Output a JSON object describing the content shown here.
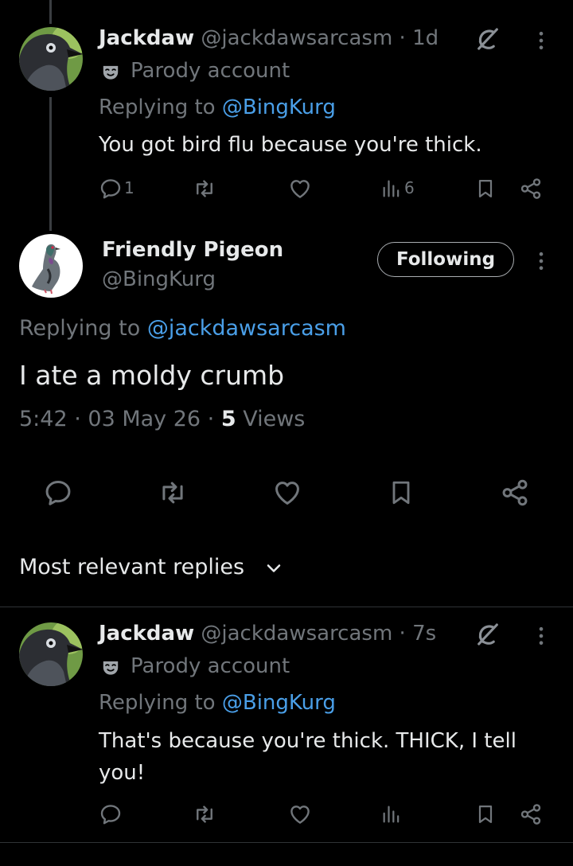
{
  "reply1": {
    "display_name": "Jackdaw",
    "handle": "@jackdawsarcasm",
    "time": "1d",
    "badge_text": "Parody account",
    "replying_prefix": "Replying to",
    "replying_to": "@BingKurg",
    "text": "You got bird flu because you're thick.",
    "reply_count": "1",
    "view_count": "6"
  },
  "main": {
    "display_name": "Friendly Pigeon",
    "handle": "@BingKurg",
    "follow_label": "Following",
    "replying_prefix": "Replying to",
    "replying_to": "@jackdawsarcasm",
    "text": "I ate a moldy crumb",
    "time": "5:42",
    "date": "03 May 26",
    "views_count": "5",
    "views_label": "Views"
  },
  "sort": {
    "label": "Most relevant replies"
  },
  "reply2": {
    "display_name": "Jackdaw",
    "handle": "@jackdawsarcasm",
    "time": "7s",
    "badge_text": "Parody account",
    "replying_prefix": "Replying to",
    "replying_to": "@BingKurg",
    "text": "That's because you're thick. THICK, I tell you!"
  },
  "icons": {
    "reply": "comment-icon",
    "repost": "repost-icon",
    "like": "heart-icon",
    "views": "views-icon",
    "bookmark": "bookmark-icon",
    "share": "share-icon",
    "more": "more-vertical-icon",
    "grok": "grok-icon",
    "parody": "mask-icon",
    "chevron": "chevron-down-icon"
  },
  "colors": {
    "background": "#000000",
    "text": "#e7e9ea",
    "muted": "#71767b",
    "link": "#4a9fe8"
  }
}
